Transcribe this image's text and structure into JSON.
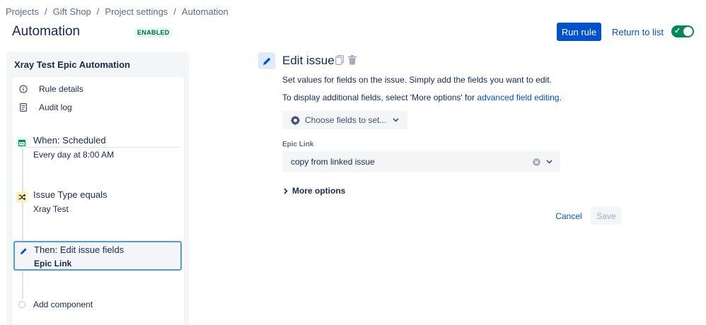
{
  "breadcrumb": [
    "Projects",
    "Gift Shop",
    "Project settings",
    "Automation"
  ],
  "breadcrumb_separator": "/",
  "header": {
    "title": "Automation",
    "status_badge": "ENABLED",
    "run_rule_label": "Run rule",
    "return_label": "Return to list",
    "toggle_enabled": true,
    "toggle_check": "✓"
  },
  "sidebar": {
    "title": "Xray Test Epic Automation",
    "items": [
      {
        "label": "Rule details",
        "icon": "info-icon"
      },
      {
        "label": "Audit log",
        "icon": "document-icon"
      }
    ],
    "steps": [
      {
        "title": "When: Scheduled",
        "subtitle": "Every day at 8:00 AM",
        "icon": "calendar-icon",
        "color": "#00875a",
        "bg": "#e3fcef"
      },
      {
        "title": "Issue Type equals",
        "subtitle": "Xray Test",
        "icon": "shuffle-icon",
        "color": "#172b4d",
        "bg": "#fff0b3"
      },
      {
        "title": "Then: Edit issue fields",
        "subtitle": "Epic Link",
        "icon": "pencil-icon",
        "color": "#0052cc",
        "bg": "#deebff"
      }
    ],
    "add_component": "Add component"
  },
  "main": {
    "title": "Edit issue",
    "desc1": "Set values for fields on the issue. Simply add the fields you want to edit.",
    "desc2_prefix": "To display additional fields, select 'More options' for ",
    "desc2_link": "advanced field editing",
    "desc2_suffix": ".",
    "choose_fields_label": "Choose fields to set...",
    "field_label": "Epic Link",
    "field_value": "copy from linked issue",
    "more_options_label": "More options",
    "cancel_label": "Cancel",
    "save_label": "Save"
  },
  "colors": {
    "primary": "#0052cc",
    "success": "#00875a",
    "text": "#172b4d",
    "muted": "#5e6c84",
    "surface": "#f4f5f7",
    "focus": "#4c9aff"
  }
}
